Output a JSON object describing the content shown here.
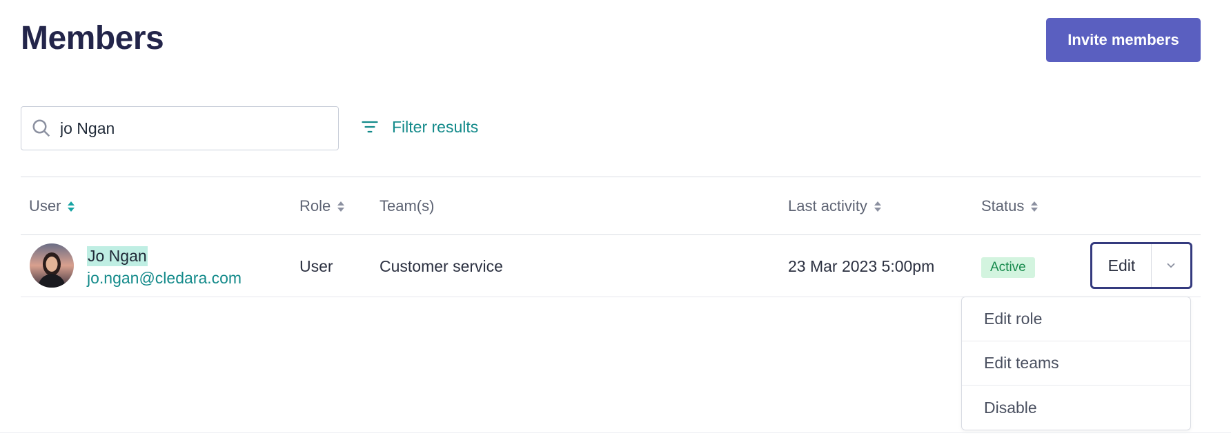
{
  "header": {
    "title": "Members",
    "invite_label": "Invite members"
  },
  "search": {
    "value": "jo Ngan",
    "icon": "search-icon"
  },
  "filter": {
    "label": "Filter results",
    "icon": "filter-icon"
  },
  "table": {
    "columns": [
      "User",
      "Role",
      "Team(s)",
      "Last activity",
      "Status"
    ],
    "rows": [
      {
        "name": "Jo Ngan",
        "email": "jo.ngan@cledara.com",
        "role": "User",
        "teams": "Customer service",
        "last_activity": "23 Mar 2023 5:00pm",
        "status": "Active",
        "edit_label": "Edit"
      }
    ]
  },
  "menu": {
    "items": [
      "Edit role",
      "Edit teams",
      "Disable"
    ]
  },
  "colors": {
    "accent": "#5a5fc0",
    "teal": "#138a8a",
    "title": "#23254a",
    "active_badge_bg": "#d3f4df",
    "active_badge_text": "#178a4c"
  }
}
